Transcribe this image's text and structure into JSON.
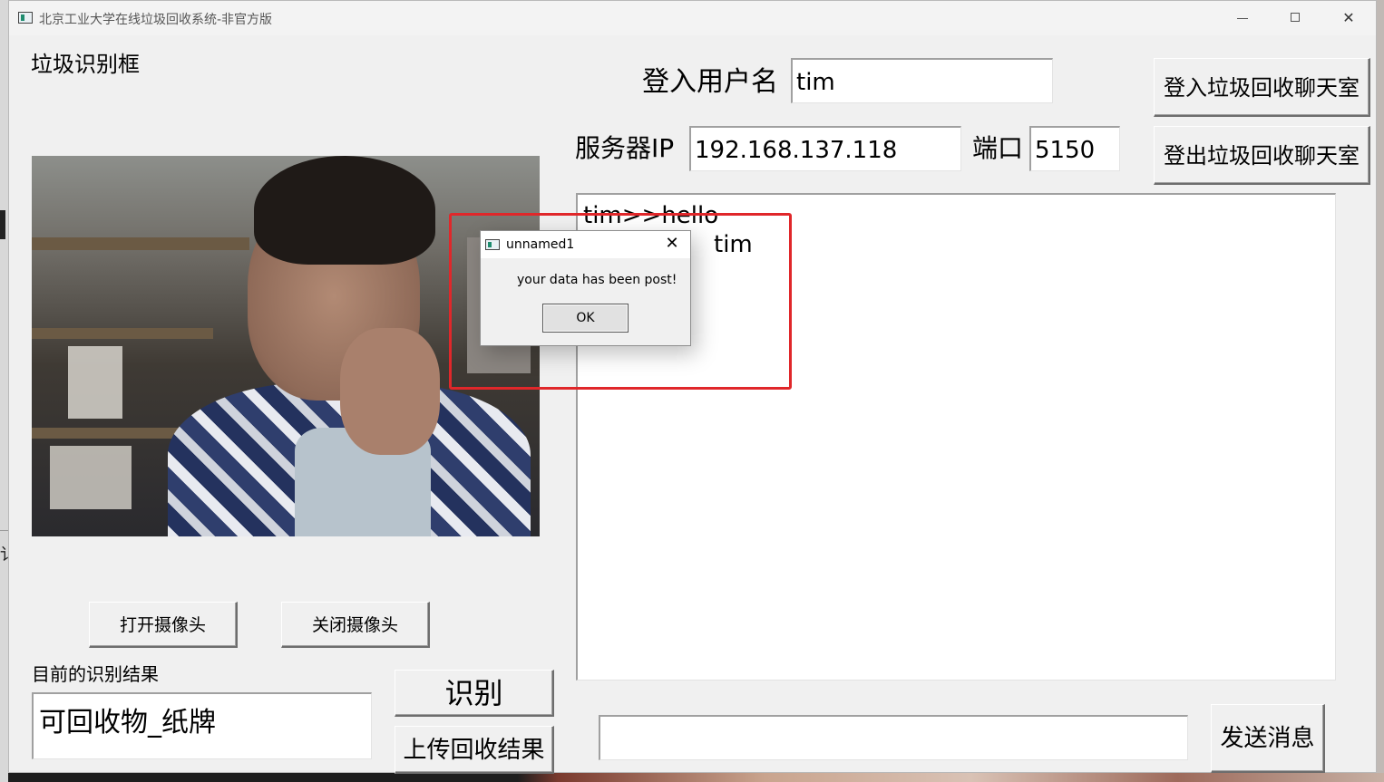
{
  "window": {
    "title": "北京工业大学在线垃圾回收系统-非官方版",
    "minimize": "—",
    "close": "✕"
  },
  "detect_frame_label": "垃圾识别框",
  "login": {
    "username_label": "登入用户名",
    "username_value": "tim",
    "login_button": "登入垃圾回收聊天室",
    "logout_button": "登出垃圾回收聊天室"
  },
  "server": {
    "ip_label": "服务器IP",
    "ip_value": "192.168.137.118",
    "port_label": "端口",
    "port_value": "5150"
  },
  "chat": {
    "line1": "tim>>hello",
    "line2": "tim",
    "message_input": "",
    "send_button": "发送消息"
  },
  "camera": {
    "open_button": "打开摄像头",
    "close_button": "关闭摄像头"
  },
  "result": {
    "label": "目前的识别结果",
    "value": "可回收物_纸牌",
    "recognize_button": "识别",
    "upload_button": "上传回收结果"
  },
  "dialog": {
    "title": "unnamed1",
    "close": "✕",
    "message": "your data has been post!",
    "ok_button": "OK"
  },
  "colors": {
    "window_bg": "#f0f0f0",
    "highlight": "#e0272a"
  }
}
